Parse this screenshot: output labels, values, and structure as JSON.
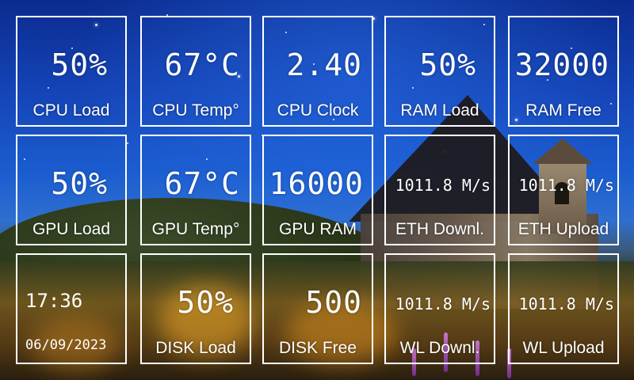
{
  "tiles": {
    "cpu_load": {
      "value": "50%",
      "label": "CPU Load"
    },
    "cpu_temp": {
      "value": "67°C",
      "label": "CPU Temp°"
    },
    "cpu_clock": {
      "value": "2.40",
      "label": "CPU Clock"
    },
    "ram_load": {
      "value": "50%",
      "label": "RAM Load"
    },
    "ram_free": {
      "value": "32000",
      "label": "RAM Free"
    },
    "gpu_load": {
      "value": "50%",
      "label": "GPU Load"
    },
    "gpu_temp": {
      "value": "67°C",
      "label": "GPU Temp°"
    },
    "gpu_ram": {
      "value": "16000",
      "label": "GPU RAM"
    },
    "eth_down": {
      "value": "1011.8 M/s",
      "label": "ETH Downl."
    },
    "eth_up": {
      "value": "1011.8 M/s",
      "label": "ETH Upload"
    },
    "clock": {
      "time": "17:36",
      "date": "06/09/2023"
    },
    "disk_load": {
      "value": "50%",
      "label": "DISK Load"
    },
    "disk_free": {
      "value": "500",
      "label": "DISK Free"
    },
    "wl_down": {
      "value": "1011.8 M/s",
      "label": "WL Downl."
    },
    "wl_up": {
      "value": "1011.8 M/s",
      "label": "WL Upload"
    }
  },
  "colors": {
    "tile_border": "#ffffff",
    "text": "#ffffff",
    "sky": "#1545b8"
  }
}
